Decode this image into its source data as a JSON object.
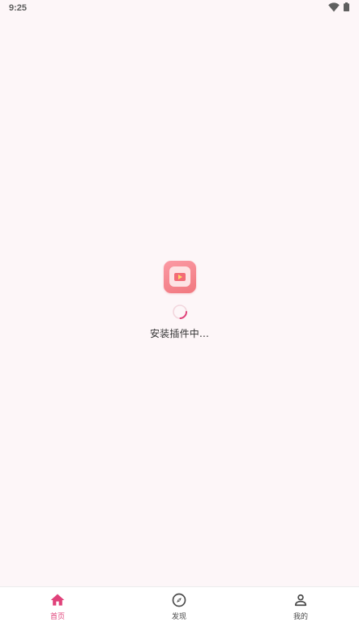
{
  "status_bar": {
    "time": "9:25",
    "icons": [
      "wifi-icon",
      "battery-icon"
    ]
  },
  "loading": {
    "app_icon": "app-logo-icon",
    "spinner_icon": "loading-spinner-icon",
    "text": "安装插件中..."
  },
  "bottom_nav": {
    "active_index": 0,
    "active_color": "#e0427a",
    "inactive_color": "#4a4a4a",
    "items": [
      {
        "label": "首页",
        "icon": "home-icon"
      },
      {
        "label": "发现",
        "icon": "compass-icon"
      },
      {
        "label": "我的",
        "icon": "person-icon"
      }
    ]
  },
  "colors": {
    "background": "#fdf6f8",
    "accent": "#e0427a",
    "app_icon": "#f57f88"
  }
}
